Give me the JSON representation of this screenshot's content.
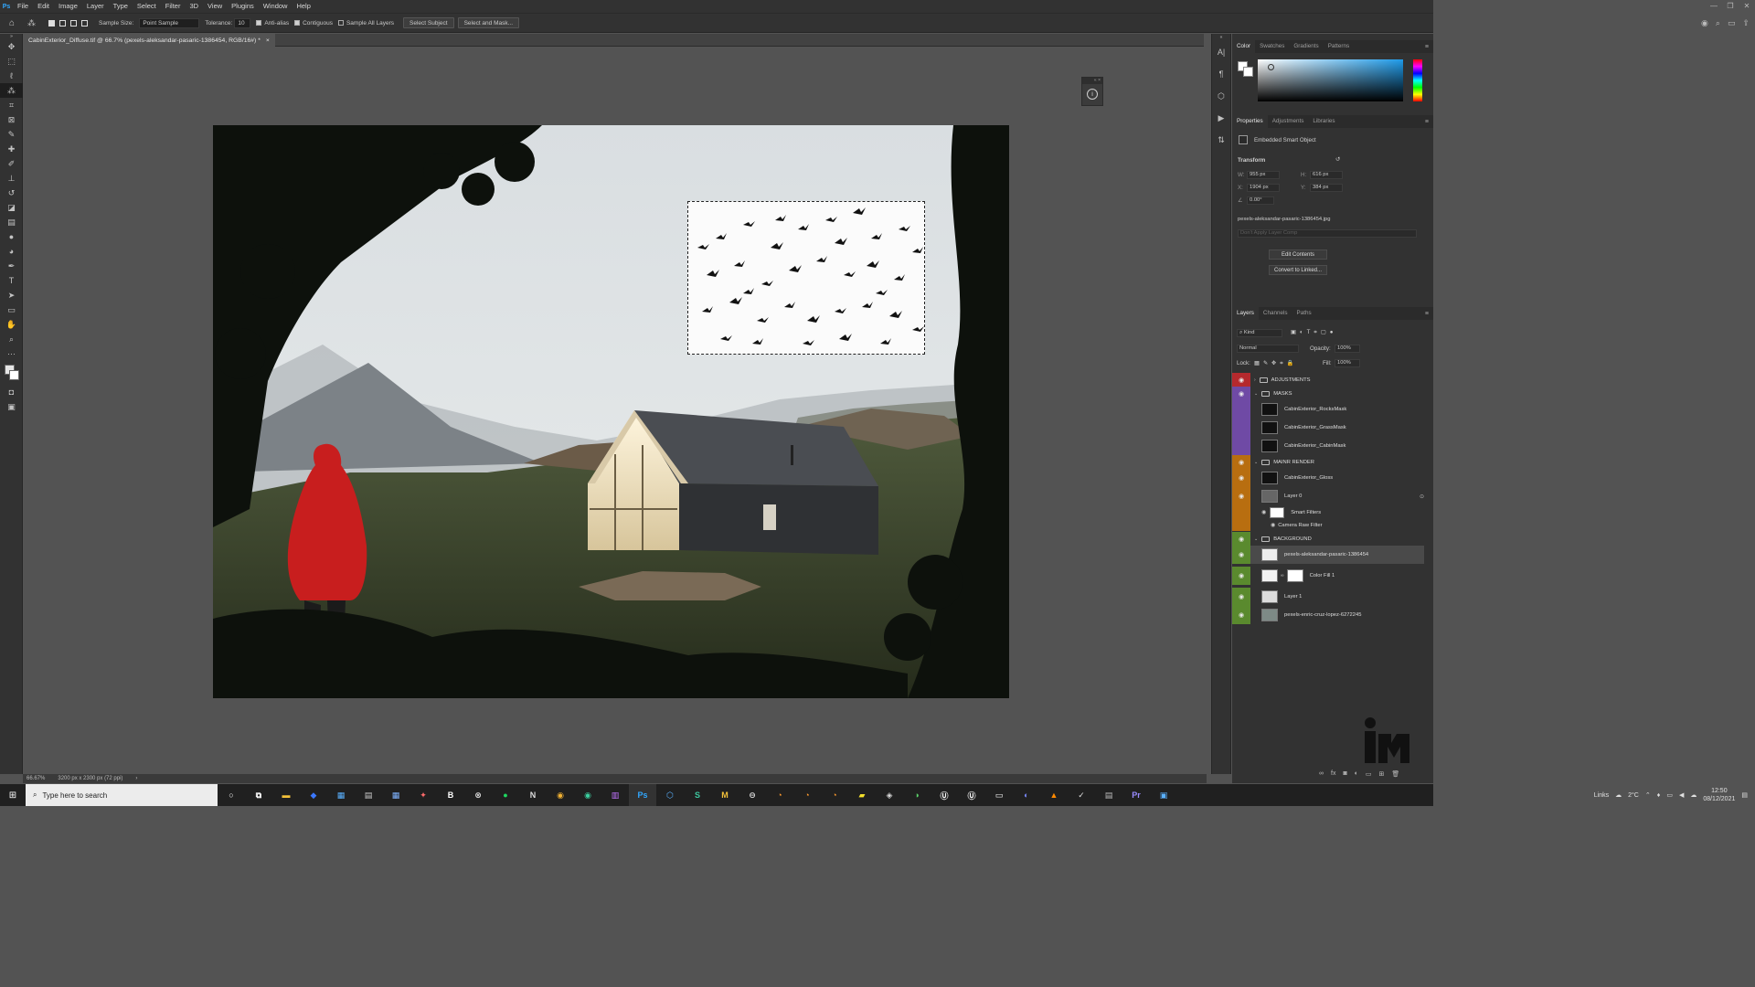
{
  "menubar": {
    "logo": "Ps",
    "items": [
      "File",
      "Edit",
      "Image",
      "Layer",
      "Type",
      "Select",
      "Filter",
      "3D",
      "View",
      "Plugins",
      "Window",
      "Help"
    ],
    "window_controls": [
      "—",
      "❐",
      "✕"
    ]
  },
  "options": {
    "sample_size_label": "Sample Size:",
    "sample_size_value": "Point Sample",
    "tolerance_label": "Tolerance:",
    "tolerance_value": "10",
    "antialias_label": "Anti-alias",
    "contiguous_label": "Contiguous",
    "sample_all_label": "Sample All Layers",
    "select_subject_label": "Select Subject",
    "select_mask_label": "Select and Mask..."
  },
  "document": {
    "tab_title": "CabinExterior_Diffuse.tif @ 66.7% (pexels-aleksandar-pasaric-1386454, RGB/16#) *",
    "close": "×"
  },
  "status": {
    "zoom": "66.67%",
    "dimensions": "3200 px x 2300 px (72 ppi)",
    "arrow": "›"
  },
  "color_panel": {
    "tabs": [
      "Color",
      "Swatches",
      "Gradients",
      "Patterns"
    ]
  },
  "properties_panel": {
    "tabs": [
      "Properties",
      "Adjustments",
      "Libraries"
    ],
    "object_type": "Embedded Smart Object",
    "transform_label": "Transform",
    "w_label": "W:",
    "w_value": "955 px",
    "h_label": "H:",
    "h_value": "616 px",
    "x_label": "X:",
    "x_value": "1904 px",
    "y_label": "Y:",
    "y_value": "384 px",
    "angle_value": "0.00°",
    "filename": "pexels-aleksandar-pasaric-1386454.jpg",
    "layer_comp": "Don't Apply Layer Comp",
    "edit_contents": "Edit Contents",
    "convert_linked": "Convert to Linked..."
  },
  "layers_panel": {
    "tabs": [
      "Layers",
      "Channels",
      "Paths"
    ],
    "filter_kind": "Kind",
    "blend_mode": "Normal",
    "opacity_label": "Opacity:",
    "opacity_value": "100%",
    "lock_label": "Lock:",
    "fill_label": "Fill:",
    "fill_value": "100%",
    "layers": [
      {
        "name": "ADJUSTMENTS",
        "group": true
      },
      {
        "name": "MASKS",
        "group": true
      },
      {
        "name": "CabinExterior_RocksMask",
        "group": false
      },
      {
        "name": "CabinExterior_GrassMask",
        "group": false
      },
      {
        "name": "CabinExterior_CabinMask",
        "group": false
      },
      {
        "name": "MAINR RENDER",
        "group": true
      },
      {
        "name": "CabinExterior_Gloss",
        "group": false
      },
      {
        "name": "Layer 0",
        "group": false
      },
      {
        "name": "Smart Filters",
        "group": false
      },
      {
        "name": "Camera Raw Filter",
        "group": false
      },
      {
        "name": "BACKGROUND",
        "group": true
      },
      {
        "name": "pexels-aleksandar-pasaric-1386454",
        "group": false
      },
      {
        "name": "Color Fill 1",
        "group": false
      },
      {
        "name": "Layer 1",
        "group": false
      },
      {
        "name": "pexels-enric-cruz-lopez-6272245",
        "group": false
      }
    ]
  },
  "colors": {
    "label_red": "#b5292d",
    "label_violet": "#6f4aa5",
    "label_orange": "#b86e10",
    "label_green": "#5a8a2e",
    "accent_blue": "#31a8ff",
    "raincoat": "#c81e1e"
  },
  "taskbar": {
    "search_placeholder": "Type here to search",
    "links_label": "Links",
    "temperature": "2°C",
    "time": "12:50",
    "date": "08/12/2021"
  }
}
